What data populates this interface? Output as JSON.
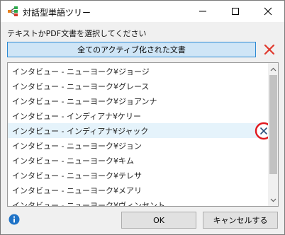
{
  "window": {
    "title": "対話型単語ツリー"
  },
  "dialog": {
    "prompt": "テキストかPDF文書を選択してください",
    "filter_button_label": "全てのアクティブ化された文書",
    "ok_label": "OK",
    "cancel_label": "キャンセルする"
  },
  "documents": [
    "インタビュー - ニューヨーク¥ジョージ",
    "インタビュー - ニューヨーク¥グレース",
    "インタビュー - ニューヨーク¥ジョアンナ",
    "インタビュー - インディアナ¥ケリー",
    "インタビュー - インディアナ¥ジャック",
    "インタビュー - ニューヨーク¥ジョン",
    "インタビュー - ニューヨーク¥キム",
    "インタビュー - ニューヨーク¥テレサ",
    "インタビュー - ニューヨーク¥メアリ",
    "インタビュー - ニューヨーク¥ヴィンセント"
  ],
  "hovered_document_index": 4,
  "colors": {
    "accent_blue": "#2d8ad3",
    "filter_bg": "#cfe5f6",
    "remove_red": "#e0382c",
    "hover_row": "#e5f3fb",
    "info_blue": "#1f73c7"
  },
  "icons": {
    "app": "word-tree-icon",
    "remove": "close-icon",
    "info": "info-icon"
  }
}
